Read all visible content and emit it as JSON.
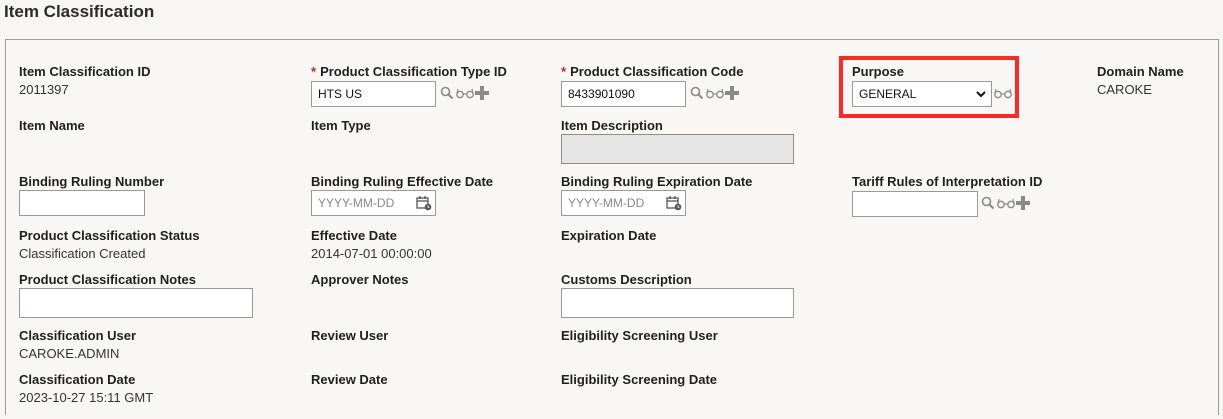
{
  "title": "Item Classification",
  "fields": {
    "item_classification_id": {
      "label": "Item Classification ID",
      "value": "2011397"
    },
    "product_classification_type_id": {
      "required": "*",
      "label": "Product Classification Type ID",
      "value": "HTS US"
    },
    "product_classification_code": {
      "required": "*",
      "label": "Product Classification Code",
      "value": "8433901090"
    },
    "purpose": {
      "label": "Purpose",
      "value": "GENERAL"
    },
    "domain_name": {
      "label": "Domain Name",
      "value": "CAROKE"
    },
    "item_name": {
      "label": "Item Name"
    },
    "item_type": {
      "label": "Item Type"
    },
    "item_description": {
      "label": "Item Description"
    },
    "binding_ruling_number": {
      "label": "Binding Ruling Number",
      "value": ""
    },
    "binding_ruling_effective_date": {
      "label": "Binding Ruling Effective Date",
      "placeholder": "YYYY-MM-DD"
    },
    "binding_ruling_expiration_date": {
      "label": "Binding Ruling Expiration Date",
      "placeholder": "YYYY-MM-DD"
    },
    "tariff_rules_id": {
      "label": "Tariff Rules of Interpretation ID",
      "value": ""
    },
    "product_classification_status": {
      "label": "Product Classification Status",
      "value": "Classification Created"
    },
    "effective_date": {
      "label": "Effective Date",
      "value": "2014-07-01 00:00:00"
    },
    "expiration_date": {
      "label": "Expiration Date"
    },
    "product_classification_notes": {
      "label": "Product Classification Notes"
    },
    "approver_notes": {
      "label": "Approver Notes"
    },
    "customs_description": {
      "label": "Customs Description"
    },
    "classification_user": {
      "label": "Classification User",
      "value": "CAROKE.ADMIN"
    },
    "review_user": {
      "label": "Review User"
    },
    "eligibility_screening_user": {
      "label": "Eligibility Screening User"
    },
    "classification_date": {
      "label": "Classification Date",
      "value": "2023-10-27 15:11 GMT"
    },
    "review_date": {
      "label": "Review Date"
    },
    "eligibility_screening_date": {
      "label": "Eligibility Screening Date"
    }
  },
  "icons": {
    "search": "search-icon",
    "view": "glasses-icon",
    "add": "plus-icon",
    "calendar": "calendar-icon",
    "dropdown": "chevron-down-icon"
  },
  "colors": {
    "highlight": "#ff2b22",
    "required": "#c62828",
    "icon": "#8a8a8a"
  }
}
